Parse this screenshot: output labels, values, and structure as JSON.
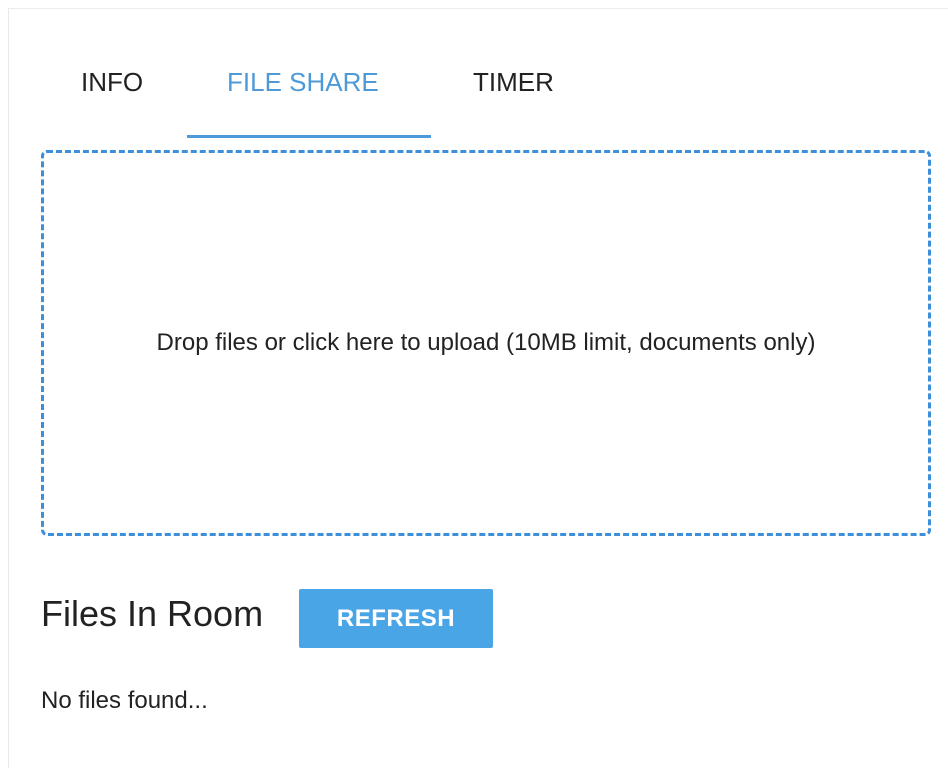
{
  "tabs": {
    "items": [
      {
        "label": "INFO",
        "active": false
      },
      {
        "label": "FILE SHARE",
        "active": true
      },
      {
        "label": "TIMER",
        "active": false
      }
    ]
  },
  "dropzone": {
    "text": "Drop files or click here to upload (10MB limit, documents only)"
  },
  "files": {
    "title": "Files In Room",
    "refresh_label": "REFRESH",
    "empty_text": "No files found..."
  },
  "colors": {
    "accent": "#4e9ad8",
    "button": "#49a5e6",
    "dropzone_border": "#3d8fd9",
    "text": "#222222"
  }
}
